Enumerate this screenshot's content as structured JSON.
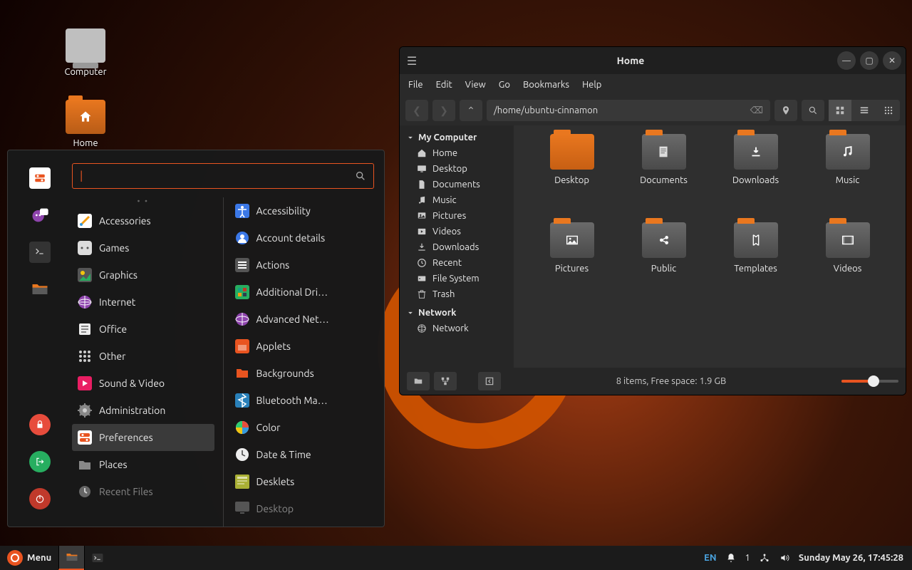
{
  "desktop": {
    "icons": [
      {
        "label": "Computer"
      },
      {
        "label": "Home"
      }
    ]
  },
  "taskbar": {
    "menu_label": "Menu",
    "lang": "EN",
    "notif": "1",
    "clock": "Sunday May 26, 17:45:28"
  },
  "menu": {
    "search_value": "",
    "categories": [
      {
        "label": "Accessories"
      },
      {
        "label": "Games"
      },
      {
        "label": "Graphics"
      },
      {
        "label": "Internet"
      },
      {
        "label": "Office"
      },
      {
        "label": "Other"
      },
      {
        "label": "Sound & Video"
      },
      {
        "label": "Administration"
      },
      {
        "label": "Preferences",
        "selected": true
      },
      {
        "label": "Places"
      },
      {
        "label": "Recent Files",
        "dim": true
      }
    ],
    "apps": [
      {
        "label": "Accessibility"
      },
      {
        "label": "Account details"
      },
      {
        "label": "Actions"
      },
      {
        "label": "Additional Dri…"
      },
      {
        "label": "Advanced Net…"
      },
      {
        "label": "Applets"
      },
      {
        "label": "Backgrounds"
      },
      {
        "label": "Bluetooth Ma…"
      },
      {
        "label": "Color"
      },
      {
        "label": "Date & Time"
      },
      {
        "label": "Desklets"
      },
      {
        "label": "Desktop",
        "dim": true
      }
    ]
  },
  "filemanager": {
    "title": "Home",
    "menubar": [
      "File",
      "Edit",
      "View",
      "Go",
      "Bookmarks",
      "Help"
    ],
    "path": "/home/ubuntu-cinnamon",
    "side_header1": "My Computer",
    "side_items1": [
      "Home",
      "Desktop",
      "Documents",
      "Music",
      "Pictures",
      "Videos",
      "Downloads",
      "Recent",
      "File System",
      "Trash"
    ],
    "side_header2": "Network",
    "side_items2": [
      "Network"
    ],
    "folders": [
      "Desktop",
      "Documents",
      "Downloads",
      "Music",
      "Pictures",
      "Public",
      "Templates",
      "Videos"
    ],
    "status": "8 items, Free space: 1.9 GB"
  }
}
